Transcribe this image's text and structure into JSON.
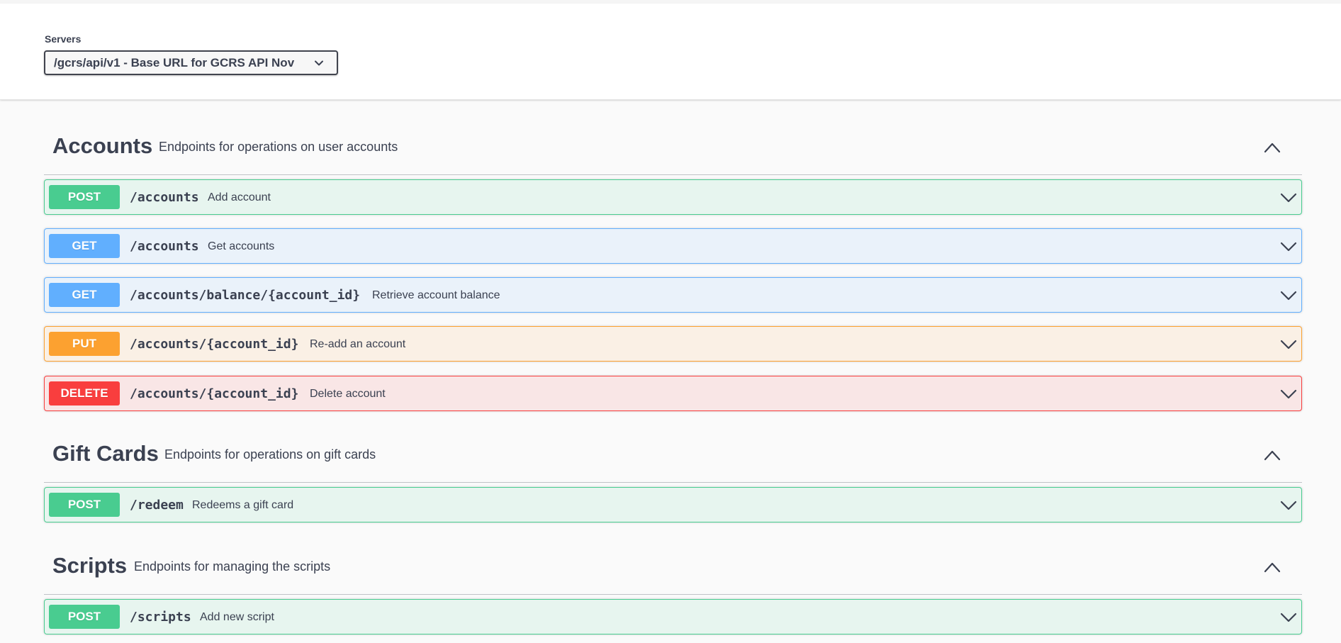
{
  "servers": {
    "label": "Servers",
    "selected": "/gcrs/api/v1 - Base URL for GCRS API Nov"
  },
  "tags": [
    {
      "name": "Accounts",
      "description": "Endpoints for operations on user accounts",
      "operations": [
        {
          "method": "POST",
          "path": "/accounts",
          "summary": "Add account"
        },
        {
          "method": "GET",
          "path": "/accounts",
          "summary": "Get accounts"
        },
        {
          "method": "GET",
          "path": "/accounts/balance/{account_id}",
          "summary": "Retrieve account balance"
        },
        {
          "method": "PUT",
          "path": "/accounts/{account_id}",
          "summary": "Re-add an account"
        },
        {
          "method": "DELETE",
          "path": "/accounts/{account_id}",
          "summary": "Delete account"
        }
      ]
    },
    {
      "name": "Gift Cards",
      "description": "Endpoints for operations on gift cards",
      "operations": [
        {
          "method": "POST",
          "path": "/redeem",
          "summary": "Redeems a gift card"
        }
      ]
    },
    {
      "name": "Scripts",
      "description": "Endpoints for managing the scripts",
      "operations": [
        {
          "method": "POST",
          "path": "/scripts",
          "summary": "Add new script"
        }
      ]
    }
  ],
  "colors": {
    "post": "#49cc90",
    "get": "#61affe",
    "put": "#fca130",
    "delete": "#f93e3e"
  }
}
